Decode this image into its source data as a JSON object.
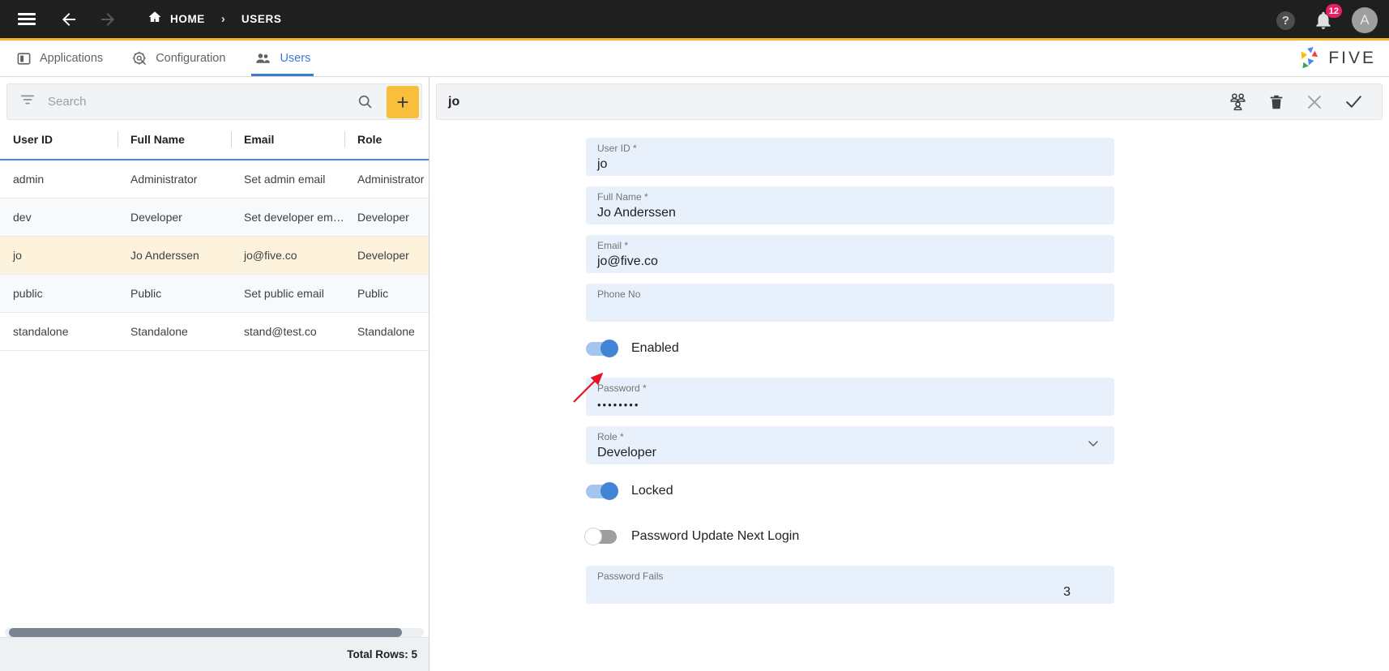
{
  "topbar": {
    "menu_icon": "hamburger-icon",
    "back_icon": "arrow-back-icon",
    "forward_icon": "arrow-forward-icon",
    "home_icon": "home-icon",
    "breadcrumb_home": "HOME",
    "breadcrumb_sep": "›",
    "breadcrumb_current": "USERS",
    "help_label": "?",
    "notification_count": "12",
    "avatar_initial": "A",
    "accent_color": "#f5b324",
    "bg_color": "#1f1f1f"
  },
  "tabs": [
    {
      "label": "Applications",
      "icon": "applications-icon",
      "active": false
    },
    {
      "label": "Configuration",
      "icon": "gear-icon",
      "active": false
    },
    {
      "label": "Users",
      "icon": "people-icon",
      "active": true
    }
  ],
  "brand": {
    "name": "FIVE"
  },
  "list_panel": {
    "search": {
      "placeholder": "Search",
      "value": ""
    },
    "filter_icon": "filter-icon",
    "search_icon": "search-icon",
    "add_button_label": "+",
    "columns": [
      "User ID",
      "Full Name",
      "Email",
      "Role"
    ],
    "rows": [
      {
        "user_id": "admin",
        "full_name": "Administrator",
        "email": "Set admin email",
        "role": "Administrator",
        "selected": false
      },
      {
        "user_id": "dev",
        "full_name": "Developer",
        "email": "Set developer em…",
        "role": "Developer",
        "selected": false
      },
      {
        "user_id": "jo",
        "full_name": "Jo Anderssen",
        "email": "jo@five.co",
        "role": "Developer",
        "selected": true
      },
      {
        "user_id": "public",
        "full_name": "Public",
        "email": "Set public email",
        "role": "Public",
        "selected": false
      },
      {
        "user_id": "standalone",
        "full_name": "Standalone",
        "email": "stand@test.co",
        "role": "Standalone",
        "selected": false
      }
    ],
    "footer": {
      "total_rows_label": "Total Rows: 5"
    }
  },
  "detail_panel": {
    "title": "jo",
    "actions": [
      {
        "name": "group-users-icon",
        "label": ""
      },
      {
        "name": "delete-icon",
        "label": ""
      },
      {
        "name": "close-icon",
        "label": ""
      },
      {
        "name": "confirm-check-icon",
        "label": ""
      }
    ],
    "fields": [
      {
        "label": "User ID *",
        "value": "jo",
        "type": "text"
      },
      {
        "label": "Full Name *",
        "value": "Jo Anderssen",
        "type": "text"
      },
      {
        "label": "Email *",
        "value": "jo@five.co",
        "type": "text"
      },
      {
        "label": "Phone No",
        "value": "",
        "type": "text"
      }
    ],
    "enabled_toggle": {
      "label": "Enabled",
      "state": "on"
    },
    "password_field": {
      "label": "Password *",
      "value": "••••••••"
    },
    "role_field": {
      "label": "Role *",
      "value": "Developer",
      "chevron": "chevron-down-icon"
    },
    "locked_toggle": {
      "label": "Locked",
      "state": "on"
    },
    "password_update_toggle": {
      "label": "Password Update Next Login",
      "state": "off"
    },
    "password_fails_field": {
      "label": "Password Fails",
      "value": "3"
    }
  },
  "annotation": {
    "arrow_color": "#e81123",
    "points_to": "enabled-toggle"
  }
}
